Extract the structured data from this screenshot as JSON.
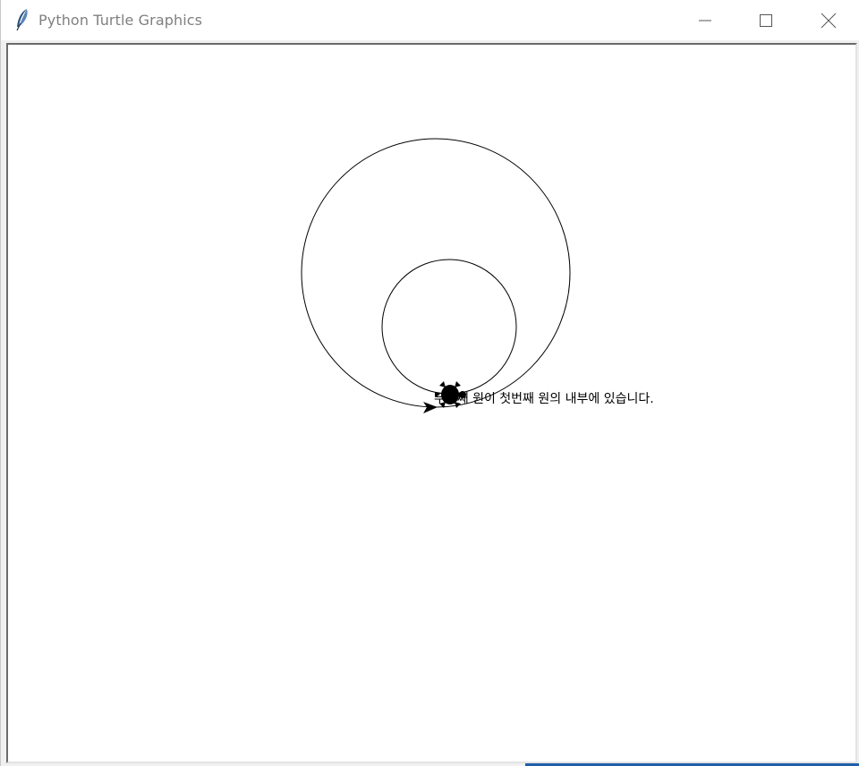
{
  "window": {
    "title": "Python Turtle Graphics",
    "icon": "feather-icon",
    "controls": {
      "minimize": "minimize-icon",
      "maximize": "maximize-icon",
      "close": "close-icon"
    }
  },
  "canvas": {
    "background": "#ffffff",
    "pen_color": "#000000",
    "message": "두번째 원이 첫번째 원의 내부에 있습니다.",
    "shapes": {
      "large_circle": "circle",
      "small_circle": "circle",
      "turtle": "turtle-icon",
      "arrow": "arrow-cursor-icon"
    }
  }
}
